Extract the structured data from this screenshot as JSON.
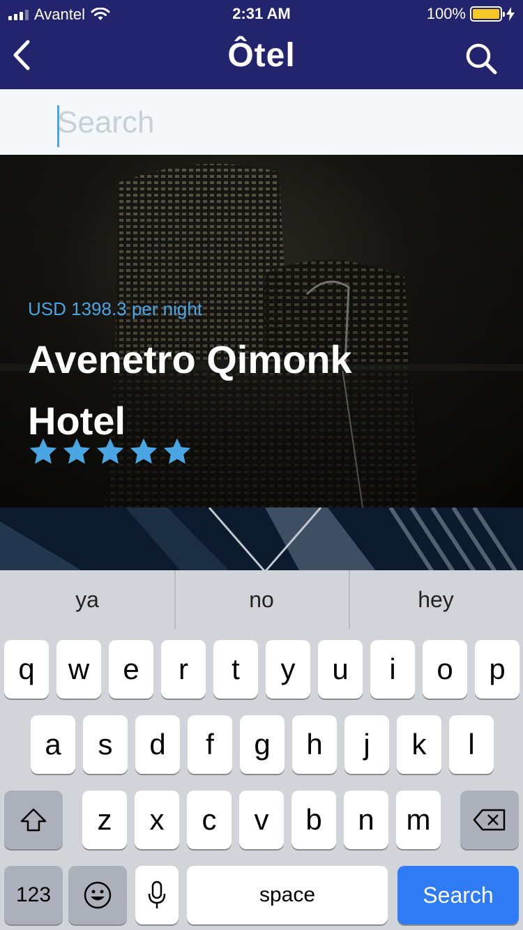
{
  "status_bar": {
    "carrier": "Avantel",
    "time": "2:31 AM",
    "battery": "100%"
  },
  "nav": {
    "title": "Ôtel",
    "back_icon": "chevron-left-icon",
    "search_icon": "search-icon"
  },
  "search": {
    "placeholder": "Search",
    "value": ""
  },
  "hotel": {
    "price": "USD 1398.3 per night",
    "name": "Avenetro Qimonk Hotel",
    "rating": 5,
    "rating_max": 5
  },
  "keyboard": {
    "suggestions": [
      "ya",
      "no",
      "hey"
    ],
    "rows": [
      [
        "q",
        "w",
        "e",
        "r",
        "t",
        "y",
        "u",
        "i",
        "o",
        "p"
      ],
      [
        "a",
        "s",
        "d",
        "f",
        "g",
        "h",
        "j",
        "k",
        "l"
      ],
      [
        "z",
        "x",
        "c",
        "v",
        "b",
        "n",
        "m"
      ]
    ],
    "numbers_label": "123",
    "space_label": "space",
    "return_label": "Search"
  },
  "colors": {
    "header": "#23246e",
    "accent": "#4aa5e3",
    "search_key": "#2f7bf5",
    "battery": "#f5c827"
  }
}
